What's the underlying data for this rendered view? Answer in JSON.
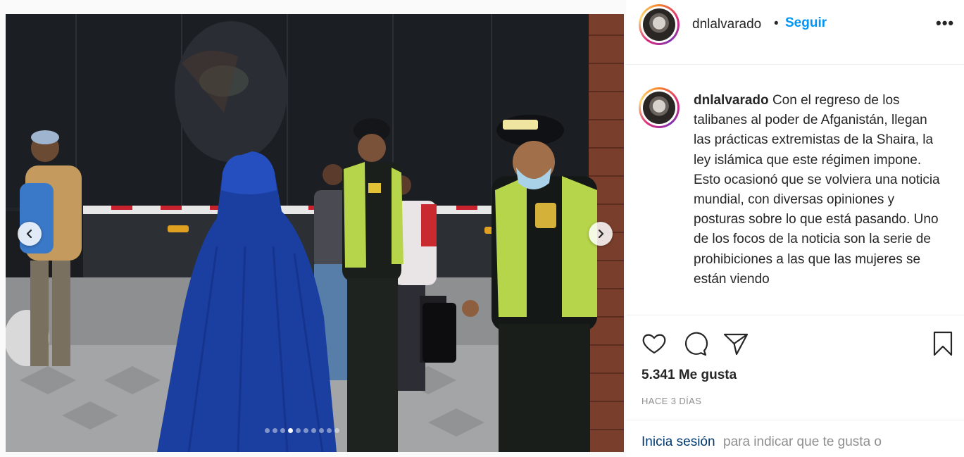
{
  "post": {
    "media": {
      "image_alt": "",
      "carousel": {
        "total": 10,
        "active_index": 3
      }
    },
    "header": {
      "username": "dnlalvarado",
      "separator": "•",
      "follow_label": "Seguir",
      "more_label": "•••"
    },
    "caption": {
      "username": "dnlalvarado",
      "text": "Con el regreso de los talibanes al poder de Afganistán, llegan las prácticas extremistas de la Shaira, la ley islámica que este régimen impone.",
      "text2": "Esto ocasionó que se volviera una noticia mundial, con diversas opiniones y posturas sobre lo que está pasando. Uno de los focos de la noticia son la serie de prohibiciones a las que las mujeres se están viendo"
    },
    "likes": "5.341 Me gusta",
    "date": "HACE 3 DÍAS",
    "login": {
      "link_label": "Inicia sesión",
      "rest_text": "para indicar que te gusta o"
    }
  },
  "icons": {
    "like": "heart-icon",
    "comment": "comment-icon",
    "share": "paper-plane-icon",
    "save": "bookmark-icon",
    "prev": "chevron-left-icon",
    "next": "chevron-right-icon"
  },
  "colors": {
    "link_blue": "#0095f6",
    "login_link": "#00376b",
    "muted": "#8e8e8e",
    "text": "#262626"
  }
}
